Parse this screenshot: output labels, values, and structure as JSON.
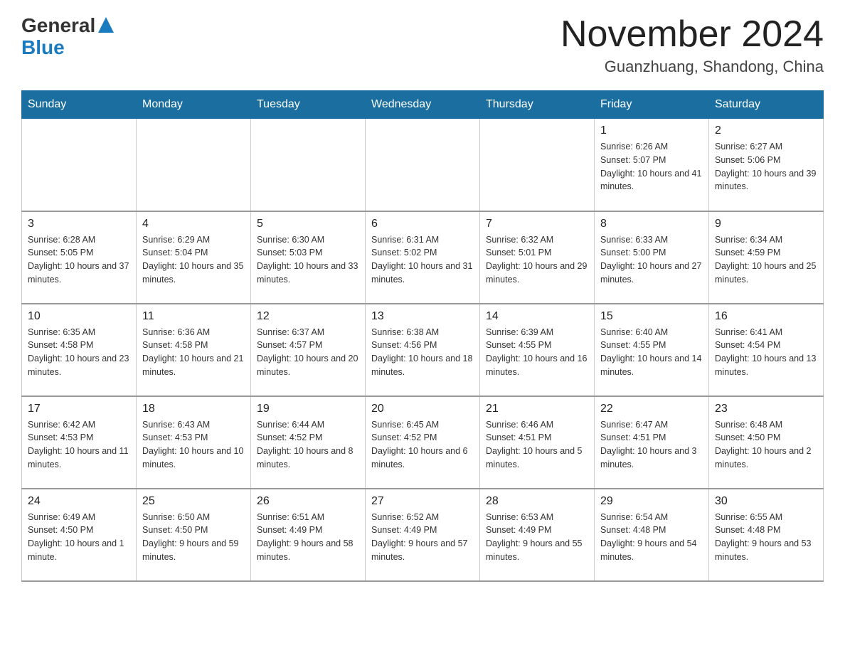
{
  "header": {
    "logo_general": "General",
    "logo_blue": "Blue",
    "month_title": "November 2024",
    "location": "Guanzhuang, Shandong, China"
  },
  "days_of_week": [
    "Sunday",
    "Monday",
    "Tuesday",
    "Wednesday",
    "Thursday",
    "Friday",
    "Saturday"
  ],
  "weeks": [
    [
      {
        "day": "",
        "info": ""
      },
      {
        "day": "",
        "info": ""
      },
      {
        "day": "",
        "info": ""
      },
      {
        "day": "",
        "info": ""
      },
      {
        "day": "",
        "info": ""
      },
      {
        "day": "1",
        "info": "Sunrise: 6:26 AM\nSunset: 5:07 PM\nDaylight: 10 hours and 41 minutes."
      },
      {
        "day": "2",
        "info": "Sunrise: 6:27 AM\nSunset: 5:06 PM\nDaylight: 10 hours and 39 minutes."
      }
    ],
    [
      {
        "day": "3",
        "info": "Sunrise: 6:28 AM\nSunset: 5:05 PM\nDaylight: 10 hours and 37 minutes."
      },
      {
        "day": "4",
        "info": "Sunrise: 6:29 AM\nSunset: 5:04 PM\nDaylight: 10 hours and 35 minutes."
      },
      {
        "day": "5",
        "info": "Sunrise: 6:30 AM\nSunset: 5:03 PM\nDaylight: 10 hours and 33 minutes."
      },
      {
        "day": "6",
        "info": "Sunrise: 6:31 AM\nSunset: 5:02 PM\nDaylight: 10 hours and 31 minutes."
      },
      {
        "day": "7",
        "info": "Sunrise: 6:32 AM\nSunset: 5:01 PM\nDaylight: 10 hours and 29 minutes."
      },
      {
        "day": "8",
        "info": "Sunrise: 6:33 AM\nSunset: 5:00 PM\nDaylight: 10 hours and 27 minutes."
      },
      {
        "day": "9",
        "info": "Sunrise: 6:34 AM\nSunset: 4:59 PM\nDaylight: 10 hours and 25 minutes."
      }
    ],
    [
      {
        "day": "10",
        "info": "Sunrise: 6:35 AM\nSunset: 4:58 PM\nDaylight: 10 hours and 23 minutes."
      },
      {
        "day": "11",
        "info": "Sunrise: 6:36 AM\nSunset: 4:58 PM\nDaylight: 10 hours and 21 minutes."
      },
      {
        "day": "12",
        "info": "Sunrise: 6:37 AM\nSunset: 4:57 PM\nDaylight: 10 hours and 20 minutes."
      },
      {
        "day": "13",
        "info": "Sunrise: 6:38 AM\nSunset: 4:56 PM\nDaylight: 10 hours and 18 minutes."
      },
      {
        "day": "14",
        "info": "Sunrise: 6:39 AM\nSunset: 4:55 PM\nDaylight: 10 hours and 16 minutes."
      },
      {
        "day": "15",
        "info": "Sunrise: 6:40 AM\nSunset: 4:55 PM\nDaylight: 10 hours and 14 minutes."
      },
      {
        "day": "16",
        "info": "Sunrise: 6:41 AM\nSunset: 4:54 PM\nDaylight: 10 hours and 13 minutes."
      }
    ],
    [
      {
        "day": "17",
        "info": "Sunrise: 6:42 AM\nSunset: 4:53 PM\nDaylight: 10 hours and 11 minutes."
      },
      {
        "day": "18",
        "info": "Sunrise: 6:43 AM\nSunset: 4:53 PM\nDaylight: 10 hours and 10 minutes."
      },
      {
        "day": "19",
        "info": "Sunrise: 6:44 AM\nSunset: 4:52 PM\nDaylight: 10 hours and 8 minutes."
      },
      {
        "day": "20",
        "info": "Sunrise: 6:45 AM\nSunset: 4:52 PM\nDaylight: 10 hours and 6 minutes."
      },
      {
        "day": "21",
        "info": "Sunrise: 6:46 AM\nSunset: 4:51 PM\nDaylight: 10 hours and 5 minutes."
      },
      {
        "day": "22",
        "info": "Sunrise: 6:47 AM\nSunset: 4:51 PM\nDaylight: 10 hours and 3 minutes."
      },
      {
        "day": "23",
        "info": "Sunrise: 6:48 AM\nSunset: 4:50 PM\nDaylight: 10 hours and 2 minutes."
      }
    ],
    [
      {
        "day": "24",
        "info": "Sunrise: 6:49 AM\nSunset: 4:50 PM\nDaylight: 10 hours and 1 minute."
      },
      {
        "day": "25",
        "info": "Sunrise: 6:50 AM\nSunset: 4:50 PM\nDaylight: 9 hours and 59 minutes."
      },
      {
        "day": "26",
        "info": "Sunrise: 6:51 AM\nSunset: 4:49 PM\nDaylight: 9 hours and 58 minutes."
      },
      {
        "day": "27",
        "info": "Sunrise: 6:52 AM\nSunset: 4:49 PM\nDaylight: 9 hours and 57 minutes."
      },
      {
        "day": "28",
        "info": "Sunrise: 6:53 AM\nSunset: 4:49 PM\nDaylight: 9 hours and 55 minutes."
      },
      {
        "day": "29",
        "info": "Sunrise: 6:54 AM\nSunset: 4:48 PM\nDaylight: 9 hours and 54 minutes."
      },
      {
        "day": "30",
        "info": "Sunrise: 6:55 AM\nSunset: 4:48 PM\nDaylight: 9 hours and 53 minutes."
      }
    ]
  ]
}
